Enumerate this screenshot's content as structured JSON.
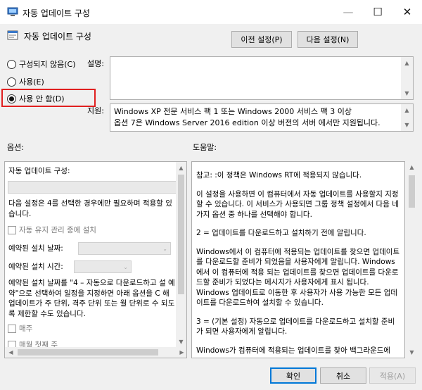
{
  "window": {
    "title": "자동 업데이트 구성",
    "minimize": "—",
    "maximize": "☐",
    "close": "✕"
  },
  "header": {
    "setting_name": "자동 업데이트 구성",
    "prev_button": "이전 설정(P)",
    "next_button": "다음 설정(N)"
  },
  "state": {
    "options": [
      {
        "label": "구성되지 않음(C)",
        "selected": false
      },
      {
        "label": "사용(E)",
        "selected": false
      },
      {
        "label": "사용 안 함(D)",
        "selected": true
      }
    ]
  },
  "labels": {
    "description": "설명:",
    "supported_on": "지원:",
    "options": "옵션:",
    "help": "도움말:"
  },
  "supported_on": {
    "line1": "Windows XP 전문 서비스 팩 1 또는 Windows 2000 서비스 팩 3 이상",
    "line2": "옵션 7은 Windows Server 2016 edition 이상 버전의 서버 에서만 지원됩니다."
  },
  "options_panel": {
    "configure_label": "자동 업데이트 구성:",
    "note": "다음 설정은 4를 선택한 경우에만 필요하며 적용할 있습니다.",
    "maintenance_checkbox": "자동 유지 관리 중에 설치",
    "install_day_label": "예약된 설치 날짜:",
    "install_time_label": "예약된 설치 시간:",
    "long_note": "예약된 설치 날짜를 \"4 – 자동으로 다운로드하고 설 예약\"으로 선택하여 일정을 지정하면 아래 옵션을 C 해 업데이트가 주 단위, 격주 단위 또는 월 단위로 수 되도록 제한할 수도 있습니다.",
    "weekly_checkbox": "매주",
    "first_week_checkbox": "매월 첫째 주"
  },
  "help_panel": {
    "p1": "참고: :이 정책은 Windows RT에 적용되지 않습니다.",
    "p2": "이 설정을 사용하면 이 컴퓨터에서 자동 업데이트를 사용할지 지정할 수 있습니다. 이 서비스가 사용되면 그룹 정책 설정에서 다음 네 가지 옵션 중 하나를 선택해야 합니다.",
    "p3": "2 = 업데이트를 다운로드하고 설치하기 전에 알립니다.",
    "p4": "Windows에서 이 컴퓨터에 적용되는 업데이트를 찾으면 업데이트를 다운로드할 준비가 되었음을 사용자에게 알립니다. Windows에서 이 컴퓨터에 적용 되는 업데이트를 찾으면 업데이트를 다운로드할 준비가 되었다는 메시지가 사용자에게 표시 됩니다. Windows 업데이트로 이동한 후 사용자가 사용 가능한 모든 업데이트를 다운로드하여 설치할 수 있습니다.",
    "p5": "3 = (기본 설정) 자동으로 업데이트를 다운로드하고 설치할 준비가 되면 사용자에게 알립니다.",
    "p6": "Windows가 컴퓨터에 적용되는 업데이트를 찾아 백그라운드에"
  },
  "footer": {
    "ok": "확인",
    "cancel": "취소",
    "apply": "적용(A)"
  }
}
